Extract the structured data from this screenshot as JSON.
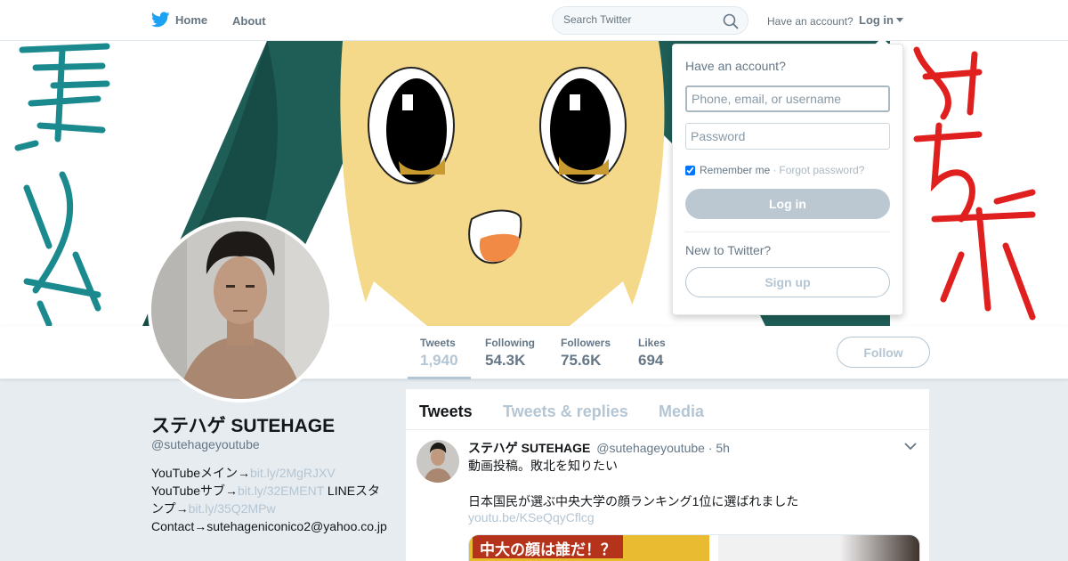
{
  "nav": {
    "home_label": "Home",
    "about_label": "About",
    "search_placeholder": "Search Twitter",
    "have_account": "Have an account?",
    "login_label": "Log in"
  },
  "profile": {
    "name": "ステハゲ SUTEHAGE",
    "handle": "@sutehageyoutube",
    "bio": {
      "line1_text": "YouTubeメイン→",
      "line1_link": "bit.ly/2MgRJXV",
      "line2_text": "YouTubeサブ→",
      "line2_link": "bit.ly/32EMENT",
      "line2_suffix": " LINEスタンプ→",
      "line3_link": "bit.ly/35Q2MPw",
      "line4_text": "Contact→sutehageniconico2@yahoo.co.jp"
    }
  },
  "stats": [
    {
      "label": "Tweets",
      "value": "1,940"
    },
    {
      "label": "Following",
      "value": "54.3K"
    },
    {
      "label": "Followers",
      "value": "75.6K"
    },
    {
      "label": "Likes",
      "value": "694"
    }
  ],
  "follow_label": "Follow",
  "timeline": {
    "tabs": [
      "Tweets",
      "Tweets & replies",
      "Media"
    ],
    "tweet": {
      "name": "ステハゲ SUTEHAGE",
      "handle": "@sutehageyoutube",
      "time": "· 5h",
      "line1": "動画投稿。敗北を知りたい",
      "line2": "日本国民が選ぶ中央大学の顔ランキング1位に選ばれました",
      "link": "youtu.be/KSeQqyCflcg",
      "card_label": "中大の顔は誰だ！？"
    }
  },
  "login_dropdown": {
    "title": "Have an account?",
    "username_placeholder": "Phone, email, or username",
    "password_placeholder": "Password",
    "remember_label": "Remember me",
    "separator": "·",
    "forgot_label": "Forgot password?",
    "login_button": "Log in",
    "new_label": "New to Twitter?",
    "signup_button": "Sign up"
  },
  "colors": {
    "brand": "#1da1f2",
    "muted": "#b4c5d3",
    "text": "#14171a"
  }
}
